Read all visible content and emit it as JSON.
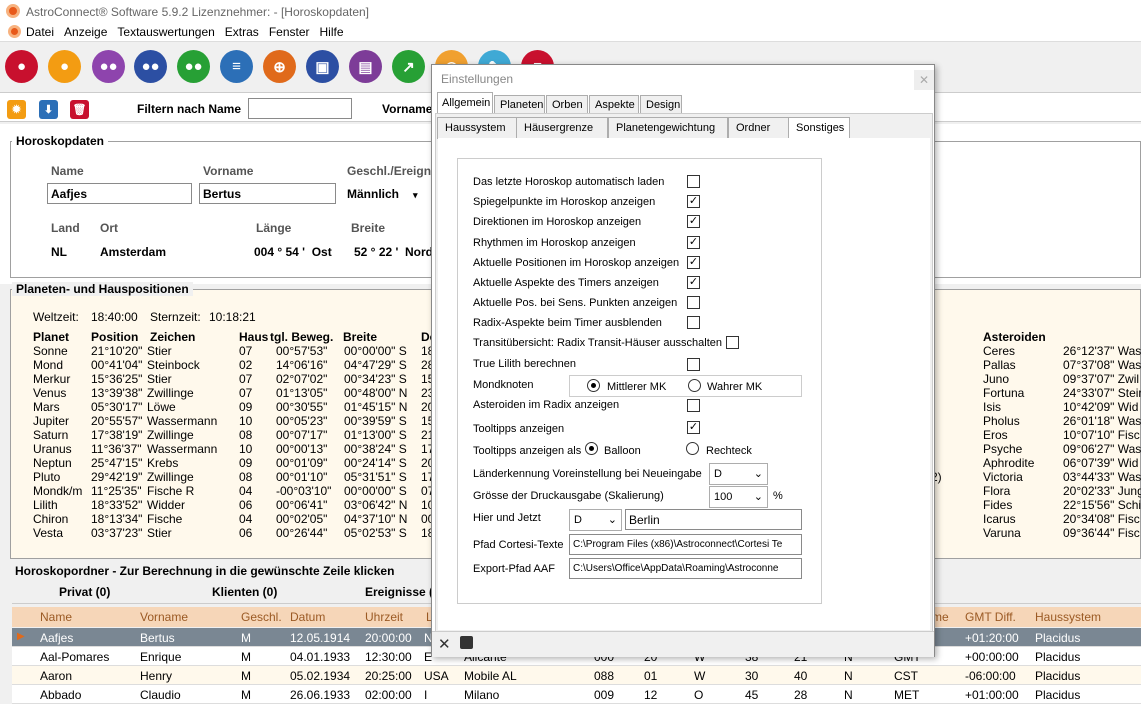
{
  "window": {
    "title": "AstroConnect® Software 5.9.2   Lizenznehmer:   - [Horoskopdaten]"
  },
  "menu": [
    "Datei",
    "Anzeige",
    "Textauswertungen",
    "Extras",
    "Fenster",
    "Hilfe"
  ],
  "toolbar_colors": [
    "#c8102e",
    "#f39c12",
    "#8e44ad",
    "#2c4fa3",
    "#27a035",
    "#2c6fb7",
    "#e06a1b",
    "#2c4fa3",
    "#7d3c98",
    "#27a035",
    "#f0a030",
    "#3fa9d5",
    "#c8102e"
  ],
  "filter": {
    "label": "Filtern nach Name",
    "vorname_label": "Vorname"
  },
  "horoskop": {
    "title": "Horoskopdaten",
    "name_label": "Name",
    "name": "Aafjes",
    "vorname_label": "Vorname",
    "vorname": "Bertus",
    "geschl_label": "Geschl./Ereign.",
    "geschl": "Männlich",
    "land_label": "Land",
    "land": "NL",
    "ort_label": "Ort",
    "ort": "Amsterdam",
    "laenge_label": "Länge",
    "laenge": "004 ° 54 '  Ost",
    "breite_label": "Breite",
    "breite": "52 ° 22 '  Nord"
  },
  "planeten": {
    "title": "Planeten- und Hauspositionen",
    "weltzeit_label": "Weltzeit:",
    "weltzeit": "18:40:00",
    "sternzeit_label": "Sternzeit:",
    "sternzeit": "10:18:21",
    "headers": [
      "Planet",
      "Position",
      "Zeichen",
      "Haus",
      "tgl. Beweg.",
      "Breite",
      "De"
    ],
    "rows": [
      [
        "Sonne",
        "21°10'20\"",
        "Stier",
        "07",
        "00°57'53\"",
        "00°00'00\" S",
        "18"
      ],
      [
        "Mond",
        "00°41'04\"",
        "Steinbock",
        "02",
        "14°06'16\"",
        "04°47'29\" S",
        "28"
      ],
      [
        "Merkur",
        "15°36'25\"",
        "Stier",
        "07",
        "02°07'02\"",
        "00°34'23\" S",
        "15"
      ],
      [
        "Venus",
        "13°39'38\"",
        "Zwillinge",
        "07",
        "01°13'05\"",
        "00°48'00\" N",
        "23"
      ],
      [
        "Mars",
        "05°30'17\"",
        "Löwe",
        "09",
        "00°30'55\"",
        "01°45'15\" N",
        "20"
      ],
      [
        "Jupiter",
        "20°55'57\"",
        "Wassermann",
        "10",
        "00°05'23\"",
        "00°39'59\" S",
        "15"
      ],
      [
        "Saturn",
        "17°38'19\"",
        "Zwillinge",
        "08",
        "00°07'17\"",
        "01°13'00\" S",
        "21"
      ],
      [
        "Uranus",
        "11°36'37\"",
        "Wassermann",
        "10",
        "00°00'13\"",
        "00°38'24\" S",
        "17"
      ],
      [
        "Neptun",
        "25°47'15\"",
        "Krebs",
        "09",
        "00°01'09\"",
        "00°24'14\" S",
        "20"
      ],
      [
        "Pluto",
        "29°42'19\"",
        "Zwillinge",
        "08",
        "00°01'10\"",
        "05°31'51\" S",
        "17"
      ],
      [
        "Mondk/m",
        "11°25'35\"",
        "Fische R",
        "04",
        "-00°03'10\"",
        "00°00'00\" S",
        "07"
      ],
      [
        "Lilith",
        "18°33'52\"",
        "Widder",
        "06",
        "00°06'41\"",
        "03°06'42\" N",
        "10"
      ],
      [
        "Chiron",
        "18°13'34\"",
        "Fische",
        "04",
        "00°02'05\"",
        "04°37'10\" N",
        "00"
      ],
      [
        "Vesta",
        "03°37'23\"",
        "Stier",
        "06",
        "00°26'44\"",
        "05°02'53\" S",
        "18"
      ]
    ],
    "asteroiden_header": "Asteroiden",
    "asteroiden": [
      [
        "Ceres",
        "26°12'37\" Was"
      ],
      [
        "Pallas",
        "07°37'08\" Was"
      ],
      [
        "Juno",
        "09°37'07\" Zwil"
      ],
      [
        "Fortuna",
        "24°33'07\" Steir"
      ],
      [
        "Isis",
        "10°42'09\" Wid"
      ],
      [
        "Pholus",
        "26°01'18\" Was"
      ],
      [
        "Eros",
        "10°07'10\" Fisc"
      ],
      [
        "Psyche",
        "09°06'27\" Was"
      ],
      [
        "Aphrodite",
        "06°07'39\" Wid"
      ],
      [
        "Victoria",
        "03°44'33\" Was"
      ],
      [
        "Flora",
        "20°02'33\" Jung"
      ],
      [
        "Fides",
        "22°15'56\" Schi"
      ],
      [
        "Icarus",
        "20°34'08\" Fisc"
      ],
      [
        "Varuna",
        "09°36'44\" Fisc"
      ]
    ],
    "side_fragments": [
      ")",
      ")",
      "2)",
      ")"
    ]
  },
  "ordner": {
    "title": "Horoskopordner - Zur Berechnung in die gewünschte Zeile klicken",
    "tabs": [
      "Privat (0)",
      "Klienten (0)",
      "Ereignisse ("
    ],
    "cols": [
      "Name",
      "Vorname",
      "Geschl.",
      "Datum",
      "Uhrzeit",
      "L",
      "me",
      "GMT Diff.",
      "Haussystem"
    ],
    "rows": [
      {
        "name": "Aafjes",
        "vorname": "Bertus",
        "g": "M",
        "datum": "12.05.1914",
        "zeit": "20:00:00",
        "l": "N",
        "ort": "",
        "c1": "",
        "c2": "",
        "c3": "",
        "c4": "",
        "c5": "",
        "c6": "",
        "tz": "",
        "gmt": "+01:20:00",
        "haus": "Placidus"
      },
      {
        "name": "Aal-Pomares",
        "vorname": "Enrique",
        "g": "M",
        "datum": "04.01.1933",
        "zeit": "12:30:00",
        "l": "E",
        "ort": "Alicante",
        "c1": "000",
        "c2": "20",
        "c3": "W",
        "c4": "38",
        "c5": "21",
        "c6": "N",
        "tz": "GMT",
        "gmt": "+00:00:00",
        "haus": "Placidus"
      },
      {
        "name": "Aaron",
        "vorname": "Henry",
        "g": "M",
        "datum": "05.02.1934",
        "zeit": "20:25:00",
        "l": "USA",
        "ort": "Mobile AL",
        "c1": "088",
        "c2": "01",
        "c3": "W",
        "c4": "30",
        "c5": "40",
        "c6": "N",
        "tz": "CST",
        "gmt": "-06:00:00",
        "haus": "Placidus"
      },
      {
        "name": "Abbado",
        "vorname": "Claudio",
        "g": "M",
        "datum": "26.06.1933",
        "zeit": "02:00:00",
        "l": "I",
        "ort": "Milano",
        "c1": "009",
        "c2": "12",
        "c3": "O",
        "c4": "45",
        "c5": "28",
        "c6": "N",
        "tz": "MET",
        "gmt": "+01:00:00",
        "haus": "Placidus"
      }
    ]
  },
  "dialog": {
    "title": "Einstellungen",
    "tabs1": [
      "Allgemein",
      "Planeten",
      "Orben",
      "Aspekte",
      "Design"
    ],
    "tabs2": [
      "Haussystem",
      "Häusergrenze",
      "Planetengewichtung",
      "Ordner",
      "Sonstiges"
    ],
    "options": [
      {
        "label": "Das letzte Horoskop automatisch laden",
        "checked": false
      },
      {
        "label": "Spiegelpunkte im Horoskop anzeigen",
        "checked": true
      },
      {
        "label": "Direktionen im Horoskop anzeigen",
        "checked": true
      },
      {
        "label": "Rhythmen im Horoskop anzeigen",
        "checked": true
      },
      {
        "label": "Aktuelle Positionen im Horoskop anzeigen",
        "checked": true
      },
      {
        "label": "Aktuelle Aspekte des Timers anzeigen",
        "checked": true
      },
      {
        "label": "Aktuelle Pos. bei Sens. Punkten anzeigen",
        "checked": false
      },
      {
        "label": "Radix-Aspekte beim Timer ausblenden",
        "checked": false
      }
    ],
    "transit_label": "Transitübersicht: Radix Transit-Häuser ausschalten",
    "lilith_label": "True Lilith berechnen",
    "mondknoten_label": "Mondknoten",
    "mk_mittel": "Mittlerer MK",
    "mk_wahr": "Wahrer MK",
    "asteroiden_label": "Asteroiden im Radix anzeigen",
    "tooltipps_label": "Tooltipps anzeigen",
    "tooltipps_als_label": "Tooltipps anzeigen als",
    "balloon": "Balloon",
    "rechteck": "Rechteck",
    "laender_label": "Länderkennung Voreinstellung bei Neueingabe",
    "laender_value": "D",
    "druck_label": "Grösse der Druckausgabe (Skalierung)",
    "druck_value": "100",
    "percent": "%",
    "hier_label": "Hier und Jetzt",
    "hier_land": "D",
    "hier_ort": "Berlin",
    "cortesi_label": "Pfad Cortesi-Texte",
    "cortesi_value": "C:\\Program Files (x86)\\Astroconnect\\Cortesi Te",
    "export_label": "Export-Pfad AAF",
    "export_value": "C:\\Users\\Office\\AppData\\Roaming\\Astroconne"
  }
}
